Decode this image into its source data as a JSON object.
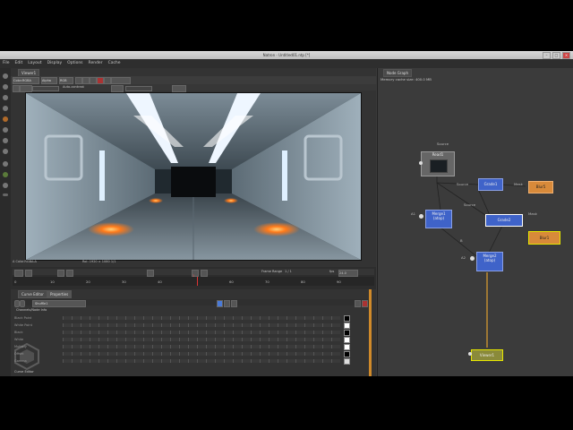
{
  "window": {
    "title": "Natron - Untitled01.ntp [*]",
    "min": "–",
    "max": "□",
    "close": "×"
  },
  "menu": [
    "File",
    "Edit",
    "Layout",
    "Display",
    "Options",
    "Render",
    "Cache"
  ],
  "viewer": {
    "tab": "Viewer1",
    "toolbar": {
      "layer": "Color.RGBA",
      "alpha": "Alpha",
      "display": "RGB",
      "auto_contrast": "Auto-contrast"
    },
    "info_left": "A Color.RGBA:A",
    "info_right": "RoI: 1920 × 1080   1/1",
    "frame_range_label": "Frame Range",
    "frame_range": "1 / 1",
    "fps": "fps",
    "fps_value": "24.0",
    "timeline_ticks": [
      "0",
      "10",
      "20",
      "30",
      "40",
      "50",
      "60",
      "70",
      "80",
      "90",
      "100"
    ],
    "current_frame": "1"
  },
  "curve_editor": {
    "tabs": [
      "Curve Editor",
      "Properties"
    ],
    "node_name": "Shuffle1",
    "header": "Channels/Node  Info",
    "rows": [
      "Black Point",
      "White Point",
      "Black",
      "White",
      "Multiply",
      "Offset",
      "Gamma"
    ],
    "footer": "Curve Editor"
  },
  "node_graph": {
    "tab": "Node Graph",
    "memory": "Memory cache size: 400.0 MB",
    "nodes": {
      "source_label": "Source",
      "read": "Read1",
      "grade1": "Grade1",
      "blur5": "Blur5",
      "merge1": "Merge1\n(atop)",
      "grade2": "Grade2",
      "blur1": "Blur1",
      "merge2": "Merge2\n(atop)",
      "viewer": "Viewer1"
    },
    "edge_labels": {
      "a1": "A1",
      "a2": "A2",
      "source": "Source",
      "mask": "Mask",
      "b": "B",
      "mask2": "Mask",
      "source2": "Source"
    }
  },
  "colors": {
    "accent_blue": "#3f63c9",
    "accent_orange": "#d88a3a",
    "select_yellow": "#e6e600"
  }
}
